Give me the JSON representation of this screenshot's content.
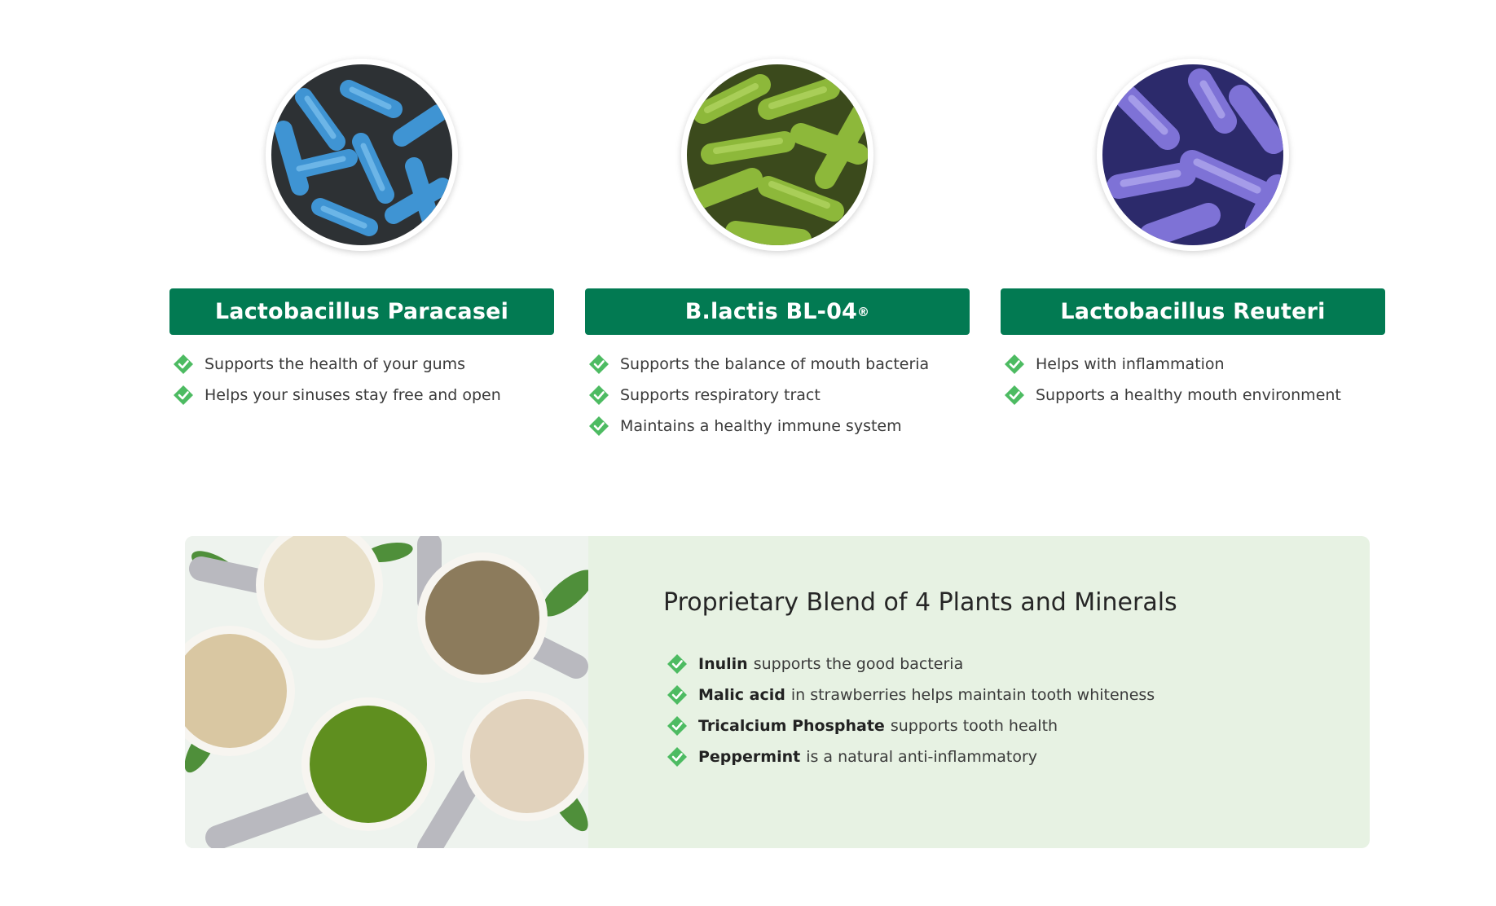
{
  "probiotics": [
    {
      "name": "Lactobacillus Paracasei",
      "suffix": "",
      "image": "blue-bacteria-micrograph",
      "benefits": [
        "Supports the health of your gums",
        "Helps your sinuses stay free and open"
      ]
    },
    {
      "name": "B.lactis BL-04",
      "suffix": "®",
      "image": "green-bacteria-micrograph",
      "benefits": [
        "Supports the balance of mouth bacteria",
        "Supports respiratory tract",
        "Maintains a healthy immune system"
      ]
    },
    {
      "name": "Lactobacillus Reuteri",
      "suffix": "",
      "image": "purple-bacteria-micrograph",
      "benefits": [
        "Helps with inflammation",
        "Supports a healthy mouth environment"
      ]
    }
  ],
  "blend": {
    "title": "Proprietary Blend of 4 Plants and Minerals",
    "image": "powder-scoops-photo",
    "items": [
      {
        "bold": "Inulin",
        "text": "supports the good bacteria"
      },
      {
        "bold": "Malic acid",
        "text": "in strawberries helps maintain tooth whiteness"
      },
      {
        "bold": "Tricalcium Phosphate",
        "text": "supports tooth health"
      },
      {
        "bold": "Peppermint",
        "text": "is a natural anti-inflammatory"
      }
    ]
  },
  "colors": {
    "title_bar": "#027a52",
    "check": "#4dbb62",
    "blend_bg": "#e7f2e3"
  },
  "icons": {
    "check": "check-diamond-icon"
  }
}
